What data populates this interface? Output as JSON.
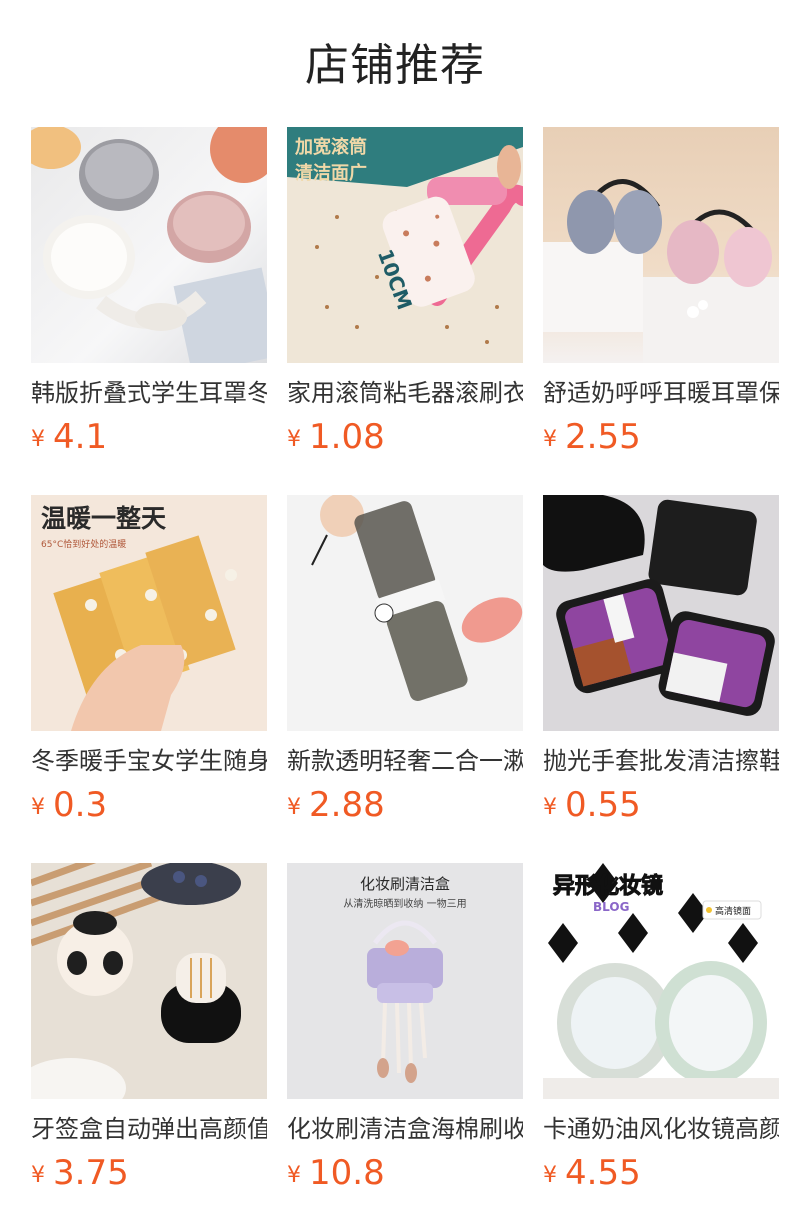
{
  "header": {
    "title": "店铺推荐"
  },
  "products": [
    {
      "name": "韩版折叠式学生耳罩冬",
      "currency": "¥",
      "price": "4.1",
      "icon": "earmuffs-image"
    },
    {
      "name": "家用滚筒粘毛器滚刷衣",
      "currency": "¥",
      "price": "1.08",
      "icon": "lint-roller-image",
      "image_text": {
        "banner_line1": "加宽滚筒",
        "banner_line2": "清洁面广",
        "size_label": "10CM"
      }
    },
    {
      "name": "舒适奶呼呼耳暖耳罩保",
      "currency": "¥",
      "price": "2.55",
      "icon": "ear-warmers-image"
    },
    {
      "name": "冬季暖手宝女学生随身",
      "currency": "¥",
      "price": "0.3",
      "icon": "hand-warmer-pack-image",
      "image_text": {
        "headline": "温暖一整天",
        "subline": "65°C恰到好处的温暖"
      }
    },
    {
      "name": "新款透明轻奢二合一漱",
      "currency": "¥",
      "price": "2.88",
      "icon": "rinse-cup-image"
    },
    {
      "name": "抛光手套批发清洁擦鞋",
      "currency": "¥",
      "price": "0.55",
      "icon": "shoe-polish-glove-image"
    },
    {
      "name": "牙签盒自动弹出高颜值",
      "currency": "¥",
      "price": "3.75",
      "icon": "toothpick-box-image"
    },
    {
      "name": "化妆刷清洁盒海棉刷收",
      "currency": "¥",
      "price": "10.8",
      "icon": "brush-cleaning-box-image",
      "image_text": {
        "headline": "化妆刷清洁盒",
        "subline": "从清洗晾晒到收纳 一物三用"
      }
    },
    {
      "name": "卡通奶油风化妆镜高颜",
      "currency": "¥",
      "price": "4.55",
      "icon": "cartoon-mirror-image",
      "image_text": {
        "headline": "异形化妆镜",
        "tag": "BLOG",
        "badge": "高清镜面"
      }
    }
  ],
  "colors": {
    "price": "#f05a24",
    "title": "#222222",
    "name": "#333333"
  }
}
